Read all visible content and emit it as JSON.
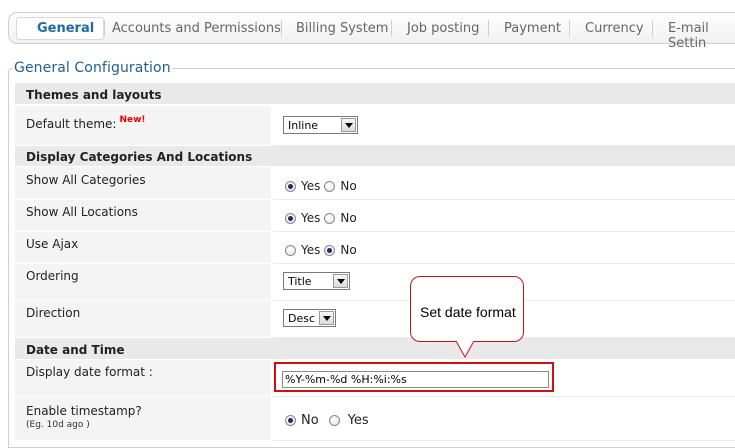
{
  "tabs": [
    {
      "label": "General",
      "active": true
    },
    {
      "label": "Accounts and Permissions"
    },
    {
      "label": "Billing System"
    },
    {
      "label": "Job posting"
    },
    {
      "label": "Payment"
    },
    {
      "label": "Currency"
    },
    {
      "label": "E-mail Settin"
    }
  ],
  "fieldset": {
    "legend": "General Configuration"
  },
  "sections": {
    "themes": "Themes and layouts",
    "display": "Display Categories And Locations",
    "datetime": "Date and Time"
  },
  "rows": {
    "default_theme": {
      "label": "Default theme:",
      "badge": "New!",
      "value": "Inline"
    },
    "show_categories": {
      "label": "Show All Categories",
      "opt1": "Yes",
      "opt2": "No",
      "selected": "Yes"
    },
    "show_locations": {
      "label": "Show All Locations",
      "opt1": "Yes",
      "opt2": "No",
      "selected": "Yes"
    },
    "use_ajax": {
      "label": "Use Ajax",
      "opt1": "Yes",
      "opt2": "No",
      "selected": "No"
    },
    "ordering": {
      "label": "Ordering",
      "value": "Title"
    },
    "direction": {
      "label": "Direction",
      "value": "Desc"
    },
    "date_format": {
      "label": "Display date format :",
      "value": "%Y-%m-%d %H:%i:%s"
    },
    "timestamp": {
      "label": "Enable timestamp?",
      "hint": "(Eg. 10d ago )",
      "opt1": "No",
      "opt2": "Yes",
      "selected": "No"
    }
  },
  "callout": {
    "text": "Set date format"
  },
  "colors": {
    "accent": "#1f6aa5",
    "highlight": "#d01010",
    "section_bg": "#e9e9e9"
  }
}
